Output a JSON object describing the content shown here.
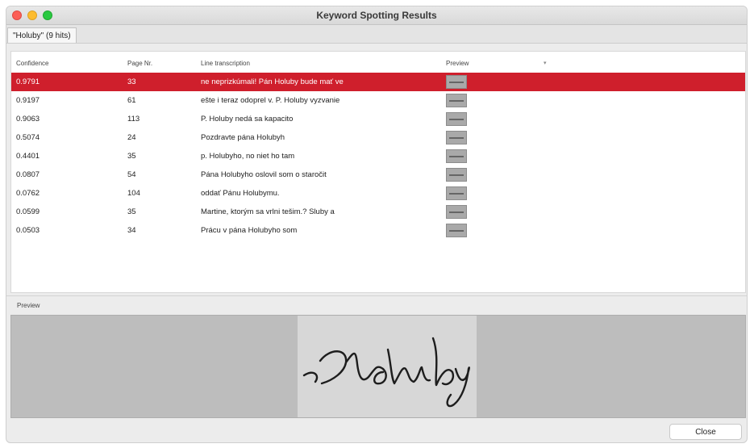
{
  "window": {
    "title": "Keyword Spotting Results"
  },
  "tabs": [
    {
      "label": "\"Holuby\" (9 hits)"
    }
  ],
  "table": {
    "columns": [
      "Confidence",
      "Page Nr.",
      "Line transcription",
      "Preview"
    ],
    "sort_indicator": "▾",
    "rows": [
      {
        "confidence": "0.9791",
        "page": "33",
        "line": "ne neprizkúmali! Pán Holuby bude mať ve",
        "selected": true
      },
      {
        "confidence": "0.9197",
        "page": "61",
        "line": "ešte i teraz odoprel v. P. Holuby vyzvanie",
        "selected": false
      },
      {
        "confidence": "0.9063",
        "page": "113",
        "line": "P. Holuby nedá sa kapacito",
        "selected": false
      },
      {
        "confidence": "0.5074",
        "page": "24",
        "line": "Pozdravte pána Holubyh",
        "selected": false
      },
      {
        "confidence": "0.4401",
        "page": "35",
        "line": "p. Holubyho, no niet ho tam",
        "selected": false
      },
      {
        "confidence": "0.0807",
        "page": "54",
        "line": "Pána Holubyho oslovil som o staročit",
        "selected": false
      },
      {
        "confidence": "0.0762",
        "page": "104",
        "line": "oddať Pánu Holubymu.",
        "selected": false
      },
      {
        "confidence": "0.0599",
        "page": "35",
        "line": "Martine, ktorým sa vrlni tešim.? Sluby a",
        "selected": false
      },
      {
        "confidence": "0.0503",
        "page": "34",
        "line": "Prácu v pána Holubyho som",
        "selected": false
      }
    ]
  },
  "preview": {
    "label": "Preview",
    "image_icon": "handwritten-word-image"
  },
  "buttons": {
    "close_label": "Close"
  },
  "colors": {
    "selection": "#cf1f2c"
  }
}
